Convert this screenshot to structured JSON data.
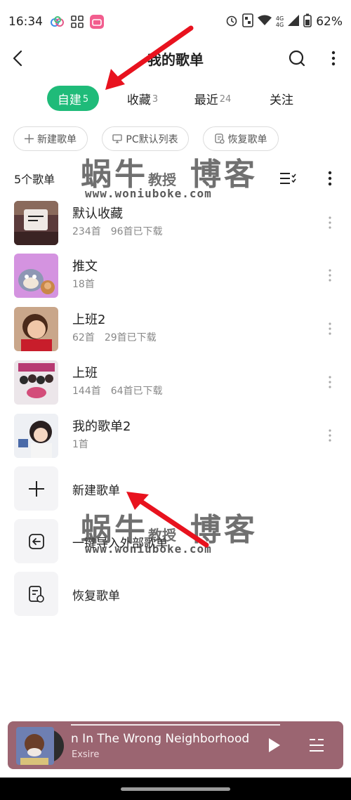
{
  "status": {
    "time": "16:34",
    "net_top": "4G",
    "net_bottom": "4G",
    "battery": "62%"
  },
  "header": {
    "title": "我的歌单"
  },
  "tabs": [
    {
      "label": "自建",
      "count": "5",
      "active": true
    },
    {
      "label": "收藏",
      "count": "3",
      "active": false
    },
    {
      "label": "最近",
      "count": "24",
      "active": false
    },
    {
      "label": "关注",
      "count": "",
      "active": false
    }
  ],
  "chips": [
    {
      "label": "新建歌单",
      "icon": "plus-icon"
    },
    {
      "label": "PC默认列表",
      "icon": "monitor-icon"
    },
    {
      "label": "恢复歌单",
      "icon": "restore-icon"
    }
  ],
  "list_head": {
    "title": "5个歌单"
  },
  "playlists": [
    {
      "name": "默认收藏",
      "songs": "234首",
      "downloaded": "96首已下载"
    },
    {
      "name": "推文",
      "songs": "18首",
      "downloaded": ""
    },
    {
      "name": "上班2",
      "songs": "62首",
      "downloaded": "29首已下载"
    },
    {
      "name": "上班",
      "songs": "144首",
      "downloaded": "64首已下载"
    },
    {
      "name": "我的歌单2",
      "songs": "1首",
      "downloaded": ""
    }
  ],
  "actions": [
    {
      "label": "新建歌单",
      "icon": "plus-icon"
    },
    {
      "label": "一键导入外部歌单",
      "icon": "import-icon"
    },
    {
      "label": "恢复歌单",
      "icon": "restore-icon"
    }
  ],
  "watermark": {
    "main": "蜗牛",
    "sub": "教授",
    "tail": "博客",
    "url": "www.woniuboke.com"
  },
  "player": {
    "song": "n In The Wrong Neighborhood",
    "artist": "Exsire",
    "bar_color": "#9b6571"
  },
  "colors": {
    "accent": "#1fbb79",
    "annotation_arrow": "#e8121e"
  }
}
